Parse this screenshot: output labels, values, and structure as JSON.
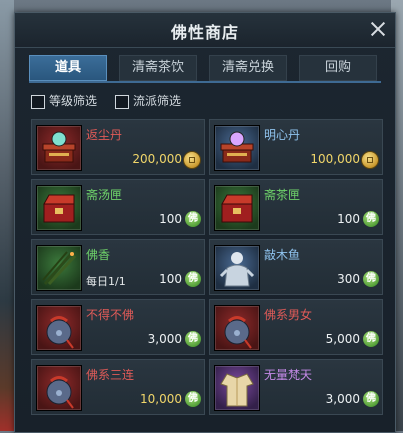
{
  "window": {
    "title": "佛性商店"
  },
  "tabs": [
    {
      "label": "道具",
      "active": true
    },
    {
      "label": "清斋茶饮",
      "active": false
    },
    {
      "label": "清斋兑换",
      "active": false
    },
    {
      "label": "回购",
      "active": false
    }
  ],
  "filters": [
    {
      "label": "等级筛选",
      "checked": false
    },
    {
      "label": "流派筛选",
      "checked": false
    }
  ],
  "currency": {
    "fo_symbol": "佛"
  },
  "items": [
    {
      "name": "返尘丹",
      "quality": "red",
      "price": "200,000",
      "price_style": "gold",
      "currency": "coin",
      "limit": "",
      "icon": "incense-box-icon"
    },
    {
      "name": "明心丹",
      "quality": "blue",
      "price": "100,000",
      "price_style": "gold",
      "currency": "coin",
      "limit": "",
      "icon": "incense-box-icon"
    },
    {
      "name": "斋汤匣",
      "quality": "green",
      "price": "100",
      "price_style": "white",
      "currency": "fo",
      "limit": "",
      "icon": "red-chest-icon"
    },
    {
      "name": "斋茶匣",
      "quality": "green",
      "price": "100",
      "price_style": "white",
      "currency": "fo",
      "limit": "",
      "icon": "red-chest-icon"
    },
    {
      "name": "佛香",
      "quality": "green",
      "price": "100",
      "price_style": "white",
      "currency": "fo",
      "limit": "每日1/1",
      "icon": "incense-sticks-icon"
    },
    {
      "name": "敲木鱼",
      "quality": "blue",
      "price": "300",
      "price_style": "white",
      "currency": "fo",
      "limit": "",
      "icon": "statue-icon"
    },
    {
      "name": "不得不佛",
      "quality": "red",
      "price": "3,000",
      "price_style": "white",
      "currency": "fo",
      "limit": "",
      "icon": "pouch-icon"
    },
    {
      "name": "佛系男女",
      "quality": "red",
      "price": "5,000",
      "price_style": "white",
      "currency": "fo",
      "limit": "",
      "icon": "pouch-icon"
    },
    {
      "name": "佛系三连",
      "quality": "red",
      "price": "10,000",
      "price_style": "gold",
      "currency": "fo",
      "limit": "",
      "icon": "pouch-icon"
    },
    {
      "name": "无量梵天",
      "quality": "purple",
      "price": "3,000",
      "price_style": "white",
      "currency": "fo",
      "limit": "",
      "icon": "robe-icon"
    }
  ]
}
